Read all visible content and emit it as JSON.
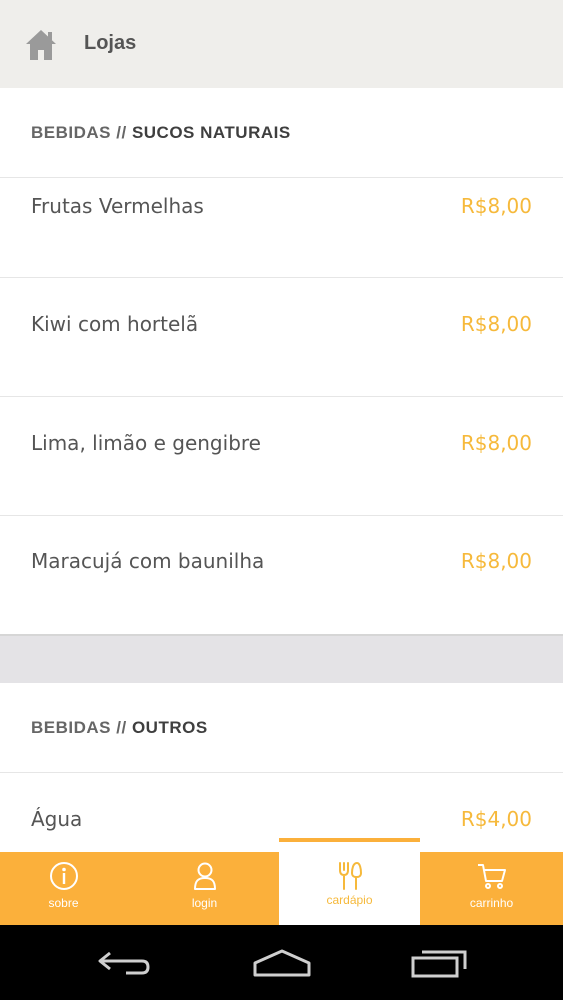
{
  "topbar": {
    "title": "Lojas",
    "icon": "home-icon"
  },
  "sections": [
    {
      "category": "BEBIDAS",
      "separator": "//",
      "subcategory": "SUCOS NATURAIS",
      "items": [
        {
          "name": "Frutas Vermelhas",
          "price": "R$8,00"
        },
        {
          "name": "Kiwi com hortelã",
          "price": "R$8,00"
        },
        {
          "name": "Lima, limão e gengibre",
          "price": "R$8,00"
        },
        {
          "name": "Maracujá com baunilha",
          "price": "R$8,00"
        }
      ]
    },
    {
      "category": "BEBIDAS",
      "separator": "//",
      "subcategory": "OUTROS",
      "items": [
        {
          "name": "Água",
          "price": "R$4,00"
        }
      ]
    }
  ],
  "bottom_nav": [
    {
      "label": "sobre",
      "icon": "info-icon",
      "active": false
    },
    {
      "label": "login",
      "icon": "user-icon",
      "active": false
    },
    {
      "label": "cardápio",
      "icon": "cutlery-icon",
      "active": true
    },
    {
      "label": "carrinho",
      "icon": "cart-icon",
      "active": false
    }
  ],
  "colors": {
    "accent": "#fbb03b",
    "price": "#f6b93b",
    "topbar_bg": "#efeeeb",
    "text": "#555555"
  }
}
